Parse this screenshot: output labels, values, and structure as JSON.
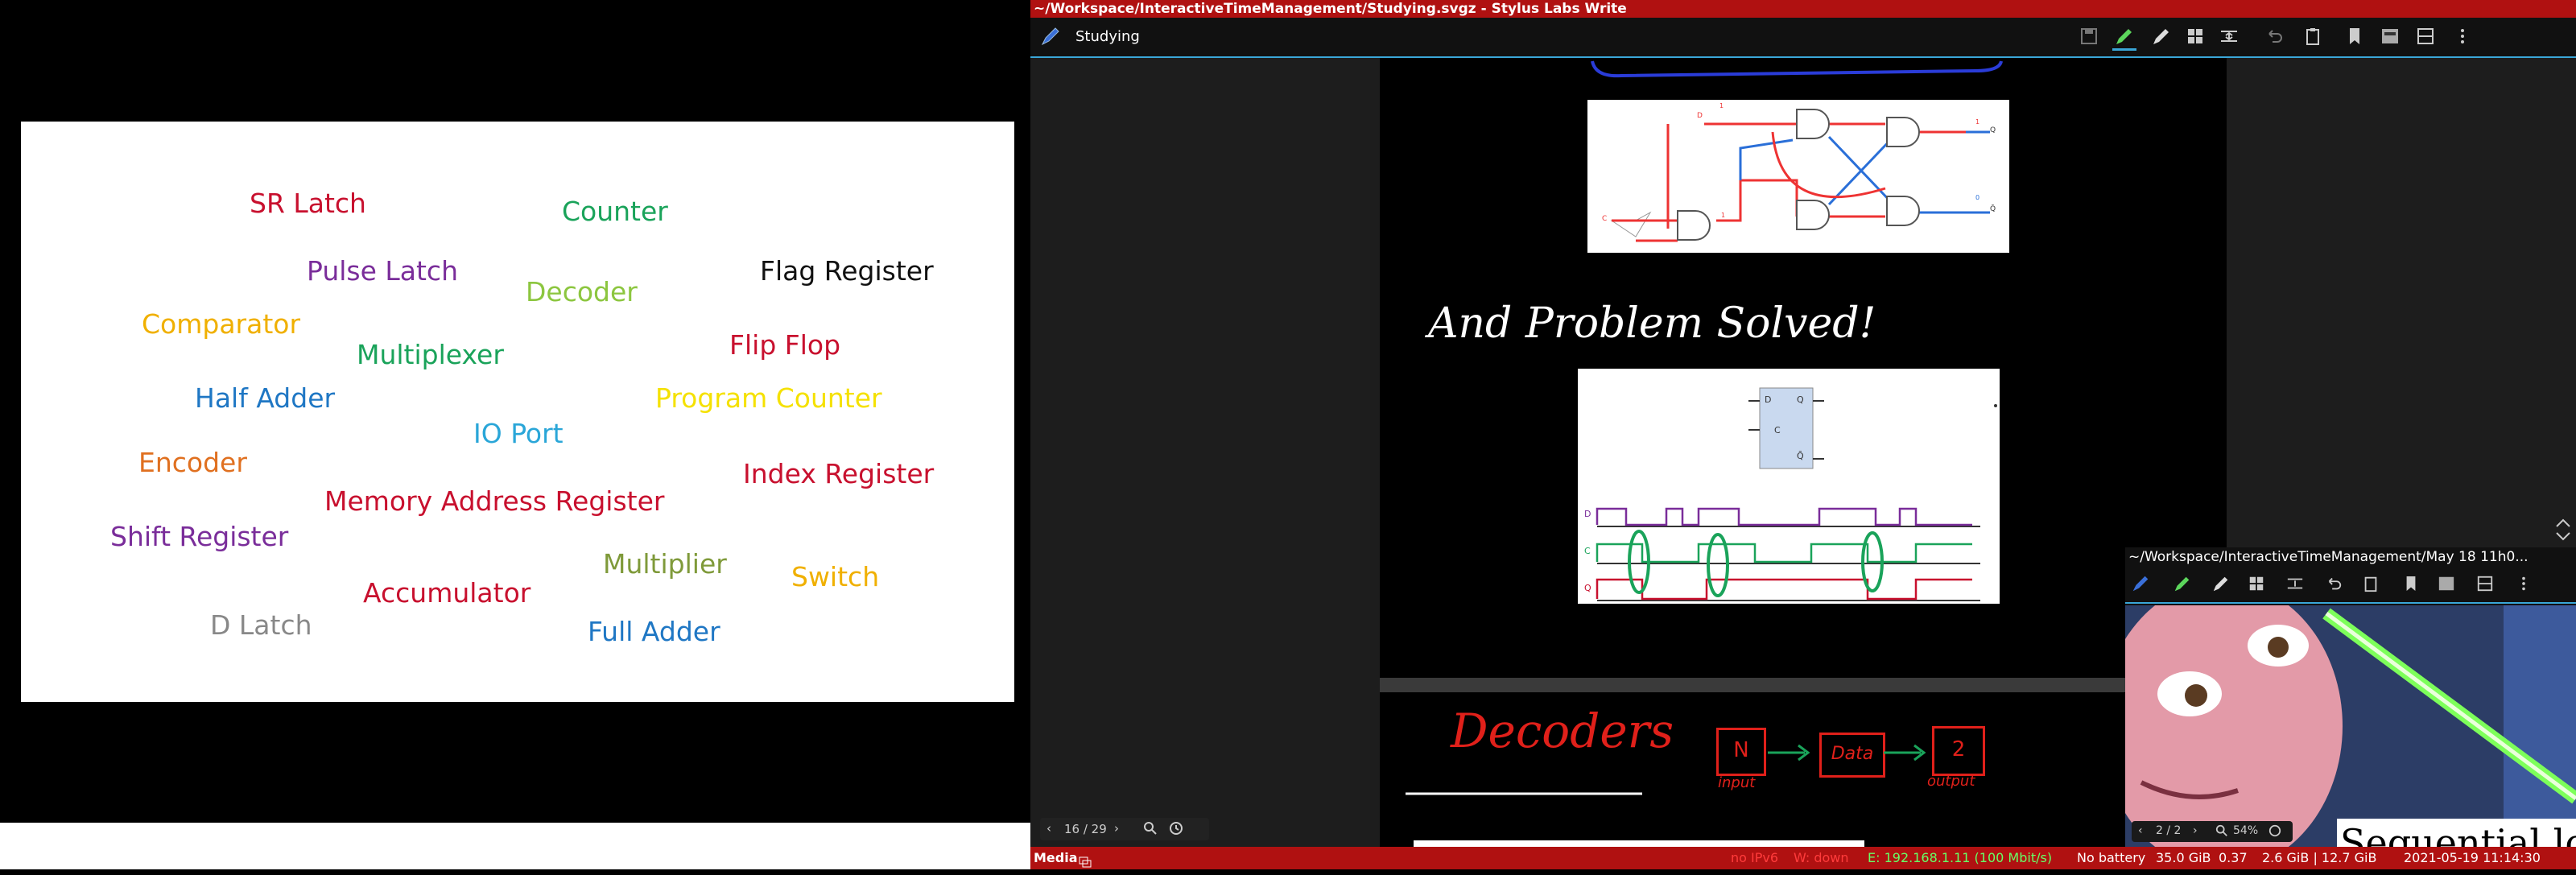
{
  "slide": {
    "words": [
      {
        "text": "SR Latch",
        "color": "#c8102e"
      },
      {
        "text": "Counter",
        "color": "#1aa35a"
      },
      {
        "text": "Pulse Latch",
        "color": "#7a2d9a"
      },
      {
        "text": "Decoder",
        "color": "#8cc63f"
      },
      {
        "text": "Flag Register",
        "color": "#111111"
      },
      {
        "text": "Comparator",
        "color": "#f0b000"
      },
      {
        "text": "Multiplexer",
        "color": "#1aa35a"
      },
      {
        "text": "Flip Flop",
        "color": "#c8102e"
      },
      {
        "text": "Half Adder",
        "color": "#1f77c4"
      },
      {
        "text": "Program Counter",
        "color": "#f5e100"
      },
      {
        "text": "IO Port",
        "color": "#2aa6d8"
      },
      {
        "text": "Encoder",
        "color": "#e07020"
      },
      {
        "text": "Index Register",
        "color": "#c8102e"
      },
      {
        "text": "Memory Address Register",
        "color": "#c8102e"
      },
      {
        "text": "Shift Register",
        "color": "#7a2d9a"
      },
      {
        "text": "Multiplier",
        "color": "#7f9a3a"
      },
      {
        "text": "Switch",
        "color": "#f0b000"
      },
      {
        "text": "Accumulator",
        "color": "#c8102e"
      },
      {
        "text": "D Latch",
        "color": "#888888"
      },
      {
        "text": "Full Adder",
        "color": "#1f77c4"
      }
    ]
  },
  "write": {
    "window_title": "~/Workspace/InteractiveTimeManagement/Studying.svgz - Stylus Labs Write",
    "doc_title": "Studying",
    "handwriting_1": "And Problem Solved!",
    "handwriting_2": "Decoders",
    "hw_box1_a": "N",
    "hw_box1_b": "input",
    "hw_box2": "Data",
    "hw_box3_a": "2",
    "hw_box3_b": "output",
    "page_nav": "16 / 29",
    "circuit": {
      "label_d": "D",
      "label_c": "C",
      "label_q": "Q",
      "label_qbar": "Q̄",
      "val_1": "1",
      "val_0": "0"
    },
    "timing": {
      "block_d": "D",
      "block_q": "Q",
      "block_c": "C",
      "block_qbar": "Q̄",
      "row_d": "D",
      "row_c": "C",
      "row_q": "Q"
    }
  },
  "status": {
    "left": "Media",
    "ipv6": "no IPv6",
    "wifi": "W: down",
    "eth": "E: 192.168.1.11 (100 Mbit/s)",
    "battery": "No battery",
    "disk": "35.0 GiB",
    "load": "0.37",
    "mem": "2.6 GiB | 12.7 GiB",
    "datetime": "2021-05-19 11:14:30"
  },
  "mini": {
    "title": "~/Workspace/InteractiveTimeManagement/May 18 11h0...",
    "page_nav": "2 / 2",
    "zoom": "54%",
    "slide_text": "Sequential logic"
  },
  "colors": {
    "accent": "#b01111",
    "highlight": "#3aa7d8"
  }
}
